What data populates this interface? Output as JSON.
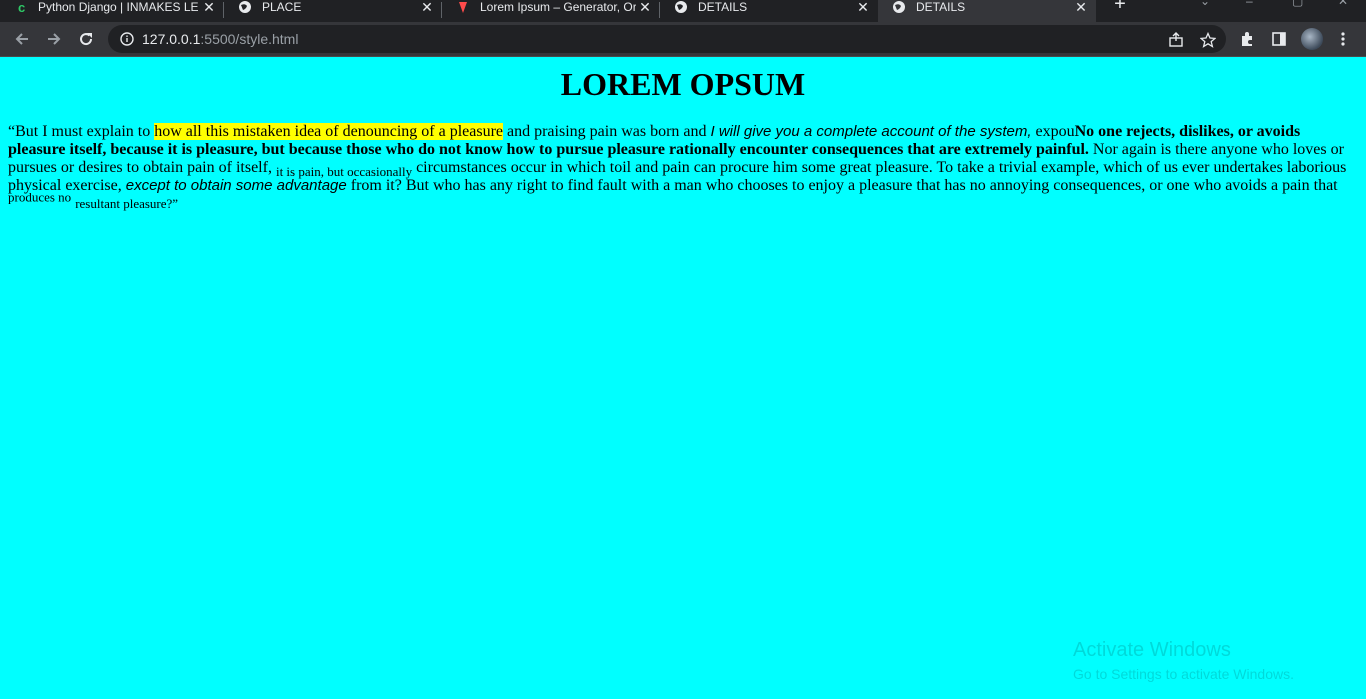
{
  "browser": {
    "tabs": [
      {
        "title": "Python Django | INMAKES LE",
        "icon": "django-icon"
      },
      {
        "title": "PLACE",
        "icon": "globe-icon"
      },
      {
        "title": "Lorem Ipsum – Generator, Or",
        "icon": "lorem-icon"
      },
      {
        "title": "DETAILS",
        "icon": "globe-icon"
      },
      {
        "title": "DETAILS",
        "icon": "globe-icon",
        "active": true
      }
    ],
    "new_tab": "+",
    "address": {
      "host": "127.0.0.1",
      "rest": ":5500/style.html"
    }
  },
  "page": {
    "heading": "LOREM OPSUM",
    "paragraph": {
      "p1": "“But I must explain to ",
      "highlight": "how all this mistaken idea of denouncing of a pleasure",
      "p2": " and praising pain was born and ",
      "italic1": "I will give you a complete account of the system,",
      "p3": " expou",
      "bold": "No one rejects, dislikes, or avoids pleasure itself, because it is pleasure, but because those who do not know how to pursue pleasure rationally encounter consequences that are extremely painful.",
      "p4": " Nor again is there anyone who loves or pursues or desires to obtain pain of itself, ",
      "sub": "it is pain, but occasionally",
      "p5": " circumstances occur in which toil and pain can procure him some great pleasure. To take a trivial example, which of us ever undertakes laborious physical exercise, ",
      "italic2": "except to obtain some advantage",
      "p6": " from it? But who has any right to find fault with a man who chooses to enjoy a pleasure that has no annoying consequences, or one who avoids a pain that ",
      "sup": "produces no",
      "small": "resultant pleasure?”"
    },
    "background": "#00ffff",
    "highlight_color": "#ffff00"
  },
  "watermark": {
    "line1": "Activate Windows",
    "line2": "Go to Settings to activate Windows."
  }
}
